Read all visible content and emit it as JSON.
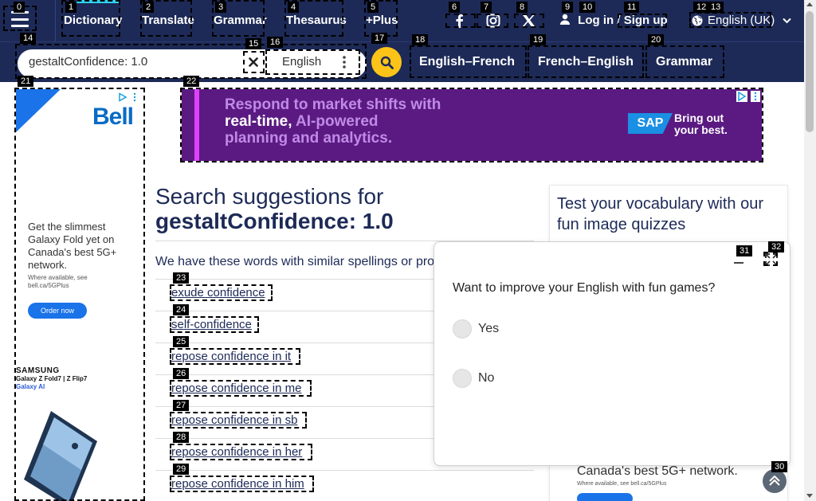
{
  "nav": {
    "links": [
      "Dictionary",
      "Translate",
      "Grammar",
      "Thesaurus",
      "+Plus"
    ],
    "login": "Log in",
    "slash": "/",
    "signup": "Sign up",
    "language": "English (UK)"
  },
  "search": {
    "value": "gestaltConfidence: 1.0",
    "language": "English",
    "tabs": [
      "English–French",
      "French–English",
      "Grammar"
    ]
  },
  "ads": {
    "bell_logo": "Bell",
    "bell_text": "Get the slimmest Galaxy Fold yet on Canada's best 5G+ network.",
    "bell_small": "Where available, see bell.ca/5GPlus",
    "bell_order": "Order now",
    "samsung_brand": "SAMSUNG",
    "samsung_model": "Galaxy Z Fold7 | Z Flip7",
    "samsung_ai": "Galaxy AI",
    "sap_line1": "Respond to market shifts with",
    "sap_line2_bold": "real-time,",
    "sap_line2_rest": " AI-powered",
    "sap_line3": "planning and analytics.",
    "sap_logo": "SAP",
    "sap_tag1": "Bring out",
    "sap_tag2": "your best.",
    "bottom_text": "Canada's best 5G+ network.",
    "bottom_small": "Where available, see bell.ca/5GPlus"
  },
  "main": {
    "heading": "Search suggestions for",
    "query": "gestaltConfidence: 1.0",
    "intro": "We have these words with similar spellings or pro",
    "suggestions": [
      "exude confidence",
      "self-confidence",
      "repose confidence in it",
      "repose confidence in me",
      "repose confidence in sb",
      "repose confidence in her",
      "repose confidence in him"
    ]
  },
  "quiz": {
    "title": "Test your vocabulary with our fun image quizzes"
  },
  "popup": {
    "question": "Want to improve your English with fun games?",
    "options": [
      "Yes",
      "No"
    ]
  },
  "marks": [
    "0",
    "1",
    "2",
    "3",
    "4",
    "5",
    "6",
    "7",
    "8",
    "9",
    "10",
    "11",
    "12",
    "13",
    "14",
    "15",
    "16",
    "17",
    "18",
    "19",
    "20",
    "21",
    "22",
    "23",
    "24",
    "25",
    "26",
    "27",
    "28",
    "29",
    "30",
    "31",
    "32"
  ],
  "colors": {
    "nav_bg": "#1d2a57",
    "accent_yellow": "#fcc419",
    "active_cyan": "#2ed3f5",
    "sap_purple": "#5b1a82"
  }
}
